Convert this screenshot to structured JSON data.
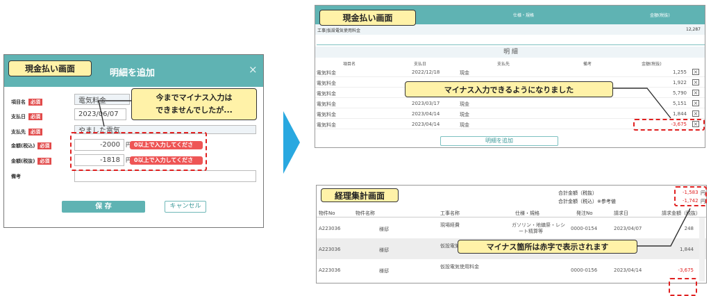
{
  "left": {
    "callout": "現金払い画面",
    "title": "明細を追加",
    "close": "×",
    "labels": {
      "item": "項目名",
      "date": "支払日",
      "payee": "支払先",
      "amount_ex": "金額(税込)",
      "amount_in": "金額(税抜)",
      "note": "備考"
    },
    "required": "必須",
    "values": {
      "item": "電気料金",
      "date": "2023/06/07",
      "payee": "やました電気",
      "amount_ex": "-2000",
      "amount_in": "-1818"
    },
    "unit": "円",
    "error": "0以上で入力してください。",
    "note_callout_line1": "今までマイナス入力は",
    "note_callout_line2": "できませんでしたが...",
    "save": "保 存",
    "cancel": "キャンセル"
  },
  "right_top": {
    "callout": "現金払い画面",
    "header_spec": "仕様・規格",
    "header_amount": "金額(税抜)",
    "summary_row": {
      "label": "工事|仮設電気使用料金",
      "amount": "12,287"
    },
    "section_title": "明 細",
    "columns": [
      "項目名",
      "支払日",
      "支払先",
      "備考",
      "金額(税抜)"
    ],
    "rows": [
      {
        "item": "電気料金",
        "date": "2022/12/18",
        "payee": "現金",
        "amount": "1,255"
      },
      {
        "item": "電気料金",
        "date": "",
        "payee": "",
        "amount": "1,922"
      },
      {
        "item": "電気料金",
        "date": "",
        "payee": "",
        "amount": "5,790"
      },
      {
        "item": "電気料金",
        "date": "2023/03/17",
        "payee": "現金",
        "amount": "5,151"
      },
      {
        "item": "電気料金",
        "date": "2023/04/14",
        "payee": "現金",
        "amount": "1,844"
      },
      {
        "item": "電気料金",
        "date": "2023/04/14",
        "payee": "現金",
        "amount": "-3,675"
      }
    ],
    "note_callout": "マイナス入力できるようになりました",
    "add_button": "明細を追加"
  },
  "right_bottom": {
    "callout": "経理集計画面",
    "total_ex_label": "合計金額（税抜）",
    "total_in_label": "合計金額（税込）※参考値",
    "total_ex": "-1,583",
    "total_in": "-1,742",
    "unit": "円",
    "columns": [
      "物件No",
      "物件名称",
      "工事名称",
      "仕様・規格",
      "発注No",
      "請求日",
      "請求金額（税抜）"
    ],
    "rows": [
      {
        "no": "A223036",
        "name": "様邸",
        "work": "現場経費",
        "spec1": "ガソリン・地鎮祭・レシ",
        "spec2": "ート精算等",
        "order": "0000-0154",
        "date": "2023/04/07",
        "amount": "248"
      },
      {
        "no": "A223036",
        "name": "様邸",
        "work": "仮設電気",
        "spec1": "",
        "spec2": "",
        "order": "",
        "date": "",
        "amount": "1,844"
      },
      {
        "no": "A223036",
        "name": "様邸",
        "work": "仮設電気使用料金",
        "spec1": "",
        "spec2": "",
        "order": "0000-0156",
        "date": "2023/04/14",
        "amount": "-3,675"
      }
    ],
    "note_callout": "マイナス箇所は赤字で表示されます"
  }
}
